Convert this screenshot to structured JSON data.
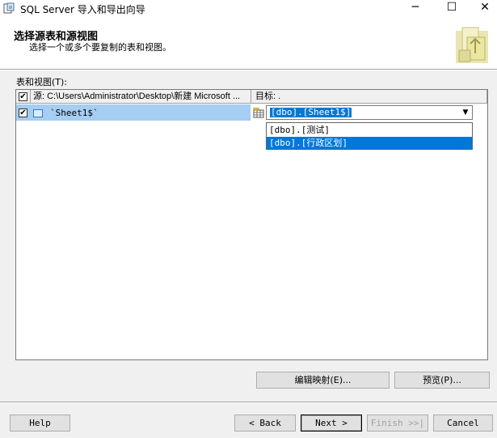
{
  "window": {
    "title": "SQL Server 导入和导出向导",
    "minimize": "─",
    "maximize": "☐",
    "close": "✕"
  },
  "header": {
    "title": "选择源表和源视图",
    "subtitle": "选择一个或多个要复制的表和视图。"
  },
  "tables_label": "表和视图(T):",
  "grid": {
    "col_source": "源: C:\\Users\\Administrator\\Desktop\\新建 Microsoft ...",
    "col_target": "目标: .",
    "rows": [
      {
        "checked": "✔",
        "source": "`Sheet1$`",
        "target": "[dbo].[Sheet1$]"
      }
    ],
    "header_check": "✔"
  },
  "dropdown": {
    "arrow": "▼",
    "options": [
      "[dbo].[测试]",
      "[dbo].[行政区划]"
    ],
    "selected_index": 1
  },
  "buttons": {
    "edit_mappings": "编辑映射(E)...",
    "preview": "预览(P)...",
    "help": "Help",
    "back": "< Back",
    "next": "Next >",
    "finish": "Finish >>|",
    "cancel": "Cancel"
  },
  "colors": {
    "selection": "#0078d7",
    "row_highlight": "#a6cdf2"
  }
}
